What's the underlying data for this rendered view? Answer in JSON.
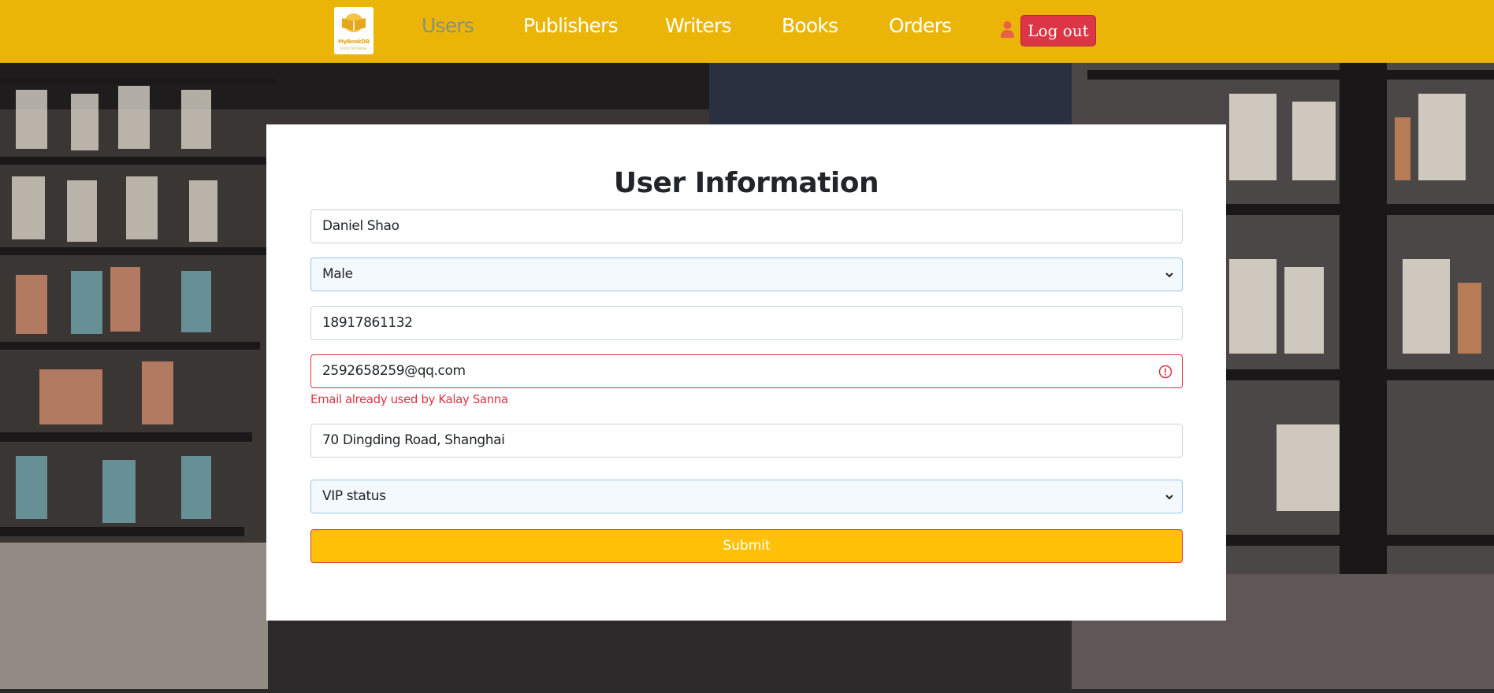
{
  "navbar": {
    "logo": {
      "icon": "book-logo-icon",
      "text_main": "MyBookDB",
      "text_sub": "BOOK DATABASE"
    },
    "links": [
      {
        "label": "Users",
        "active": true
      },
      {
        "label": "Publishers",
        "active": false
      },
      {
        "label": "Writers",
        "active": false
      },
      {
        "label": "Books",
        "active": false
      },
      {
        "label": "Orders",
        "active": false
      }
    ],
    "user_icon": "user-icon",
    "logout_label": "Log out",
    "colors": {
      "bar": "#ebb507",
      "active_link": "#8b8f7e",
      "logout": "#dc3545"
    }
  },
  "form": {
    "title": "User Information",
    "name_value": "Daniel Shao",
    "gender_value": "Male",
    "phone_value": "18917861132",
    "email_value": "2592658259@qq.com",
    "email_error": "Email already used by Kalay Sanna",
    "address_value": "70  Dingding Road, Shanghai",
    "vip_value": "VIP status",
    "submit_label": "Submit",
    "colors": {
      "submit": "#ffc107",
      "error": "#dc3545"
    }
  }
}
